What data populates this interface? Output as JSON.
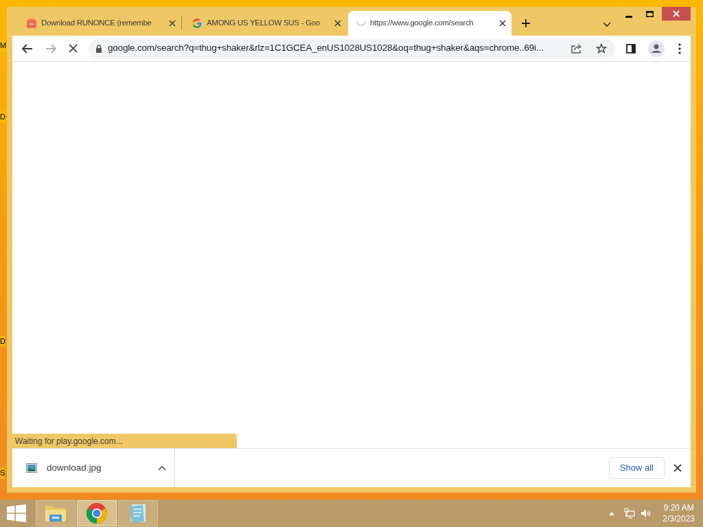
{
  "desktop_labels": [
    "M",
    "D",
    "D",
    "S"
  ],
  "browser": {
    "tabs": [
      {
        "kind": "store",
        "title": "Download RUNONCE (remembe",
        "selected": false
      },
      {
        "kind": "google",
        "title": "AMONG US YELLOW SUS - Goo",
        "selected": false
      },
      {
        "kind": "spinner",
        "title": "https://www.google.com/search",
        "selected": true
      }
    ],
    "loading": true,
    "url": "google.com/search?q=thug+shaker&rlz=1C1GCEA_enUS1028US1028&oq=thug+shaker&aqs=chrome..69i...",
    "status": "Waiting for play.google.com...",
    "downloads": [
      {
        "filename": "download.jpg"
      }
    ],
    "show_all": "Show all"
  },
  "taskbar": {
    "apps": [
      {
        "kind": "explorer",
        "selected": false
      },
      {
        "kind": "chrome",
        "selected": true
      },
      {
        "kind": "notepad",
        "selected": false
      }
    ],
    "time": "9:20 AM",
    "date": "2/3/2023"
  }
}
